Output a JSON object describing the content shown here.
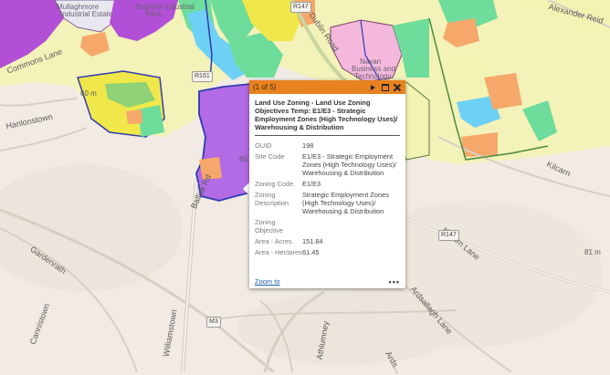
{
  "map": {
    "place_labels": {
      "mullaghmore": "Mullaghmore",
      "mullaghmore_sub": "Industrial Estate",
      "bogfarm": "Bogfarm Industrial",
      "bogfarm_sub": "Park",
      "navan_business": "Navan",
      "navan_business_2": "Business and",
      "navan_business_3": "Technology"
    },
    "road_labels": {
      "commons_lane": "Commons Lane",
      "hanlonstown": "Hanlonstown",
      "dublin_road": "Dublin Road",
      "alexander_reid": "Alexander Reid",
      "kilcarn": "Kilcarn",
      "williamstown": "Williamstown",
      "athlumney": "Athlumney",
      "ballisk": "Ballisk Rd",
      "gardenrath": "Gardenrath",
      "cannistown": "Cannistown",
      "kilcarn_lane": "Kilcarn Lane",
      "ardsallagh": "Ardsallagh Lane",
      "ardsallagh_2": "Ards..."
    },
    "contour_labels": [
      "60 m",
      "65",
      "60",
      "81 m"
    ],
    "road_shields": [
      "R147",
      "R161",
      "R147",
      "M3"
    ],
    "colors": {
      "background": "#f1ebe3",
      "residential": "#f3f3b4",
      "industrial": "#b14fd6",
      "high_tech": "#b36be5",
      "commercial": "#f6a86a",
      "open_space": "#6edc9a",
      "community": "#6fd0f5",
      "mixed_use": "#f0e84a",
      "business_park": "#f3b8dc",
      "outline": "#2d3bb0"
    }
  },
  "popup": {
    "counter": "(1 of 5)",
    "title": "Land Use Zoning - Land Use Zoning Objectives Temp: E1/E3 - Strategic Employment Zones (High Technology Uses)/ Warehousing & Distribution",
    "fields": [
      {
        "label": "GUID",
        "value": "198"
      },
      {
        "label": "Site Code",
        "value": "E1/E3 - Strategic Employment Zones (High Technology Uses)/ Warehousing & Distribution"
      },
      {
        "label": "Zoning Code",
        "value": "E1/E3"
      },
      {
        "label": "Zoning Description",
        "value": "Strategic Employment Zones (High Technology Uses)/ Warehousing & Distribution"
      },
      {
        "label": "Zoning Objective",
        "value": ""
      },
      {
        "label": "Area - Acres",
        "value": "151.84"
      },
      {
        "label": "Area - Hectares",
        "value": "61.45"
      }
    ],
    "zoom_label": "Zoom to",
    "more_label": "•••",
    "header_color": "#e8821f",
    "icons": {
      "next": "next-arrow-icon",
      "maximize": "maximize-icon",
      "close": "close-icon",
      "more": "more-options-icon"
    }
  }
}
